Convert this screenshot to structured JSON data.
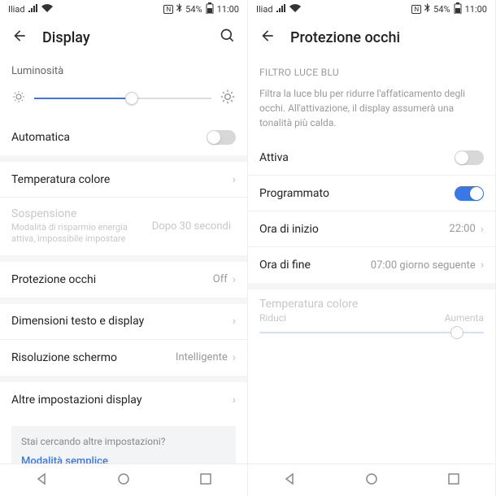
{
  "status": {
    "carrier": "Iliad",
    "battery": "54%",
    "time": "11:00",
    "nfc_icon": "nfc",
    "bt_icon": "bluetooth"
  },
  "left": {
    "title": "Display",
    "brightness_label": "Luminosità",
    "brightness_percent": 55,
    "auto_label": "Automatica",
    "auto_on": false,
    "temp_label": "Temperatura colore",
    "sleep": {
      "label": "Sospensione",
      "sub": "Modalità di risparmio energia attiva, impossibile impostare",
      "value": "Dopo 30 secondi"
    },
    "eye_label": "Protezione occhi",
    "eye_value": "Off",
    "text_size_label": "Dimensioni testo e display",
    "resolution_label": "Risoluzione schermo",
    "resolution_value": "Intelligente",
    "more_label": "Altre impostazioni display",
    "info_question": "Stai cercando altre impostazioni?",
    "info_link": "Modalità semplice"
  },
  "right": {
    "title": "Protezione occhi",
    "section": "FILTRO LUCE BLU",
    "desc": "Filtra la luce blu per ridurre l'affaticamento degli occhi. All'attivazione, il display assumerà una tonalità più calda.",
    "enable_label": "Attiva",
    "enable_on": false,
    "scheduled_label": "Programmato",
    "scheduled_on": true,
    "start_label": "Ora di inizio",
    "start_value": "22:00",
    "end_label": "Ora di fine",
    "end_value": "07:00 giorno seguente",
    "temp_label": "Temperatura colore",
    "reduce": "Riduci",
    "increase": "Aumenta",
    "temp_percent": 88
  }
}
